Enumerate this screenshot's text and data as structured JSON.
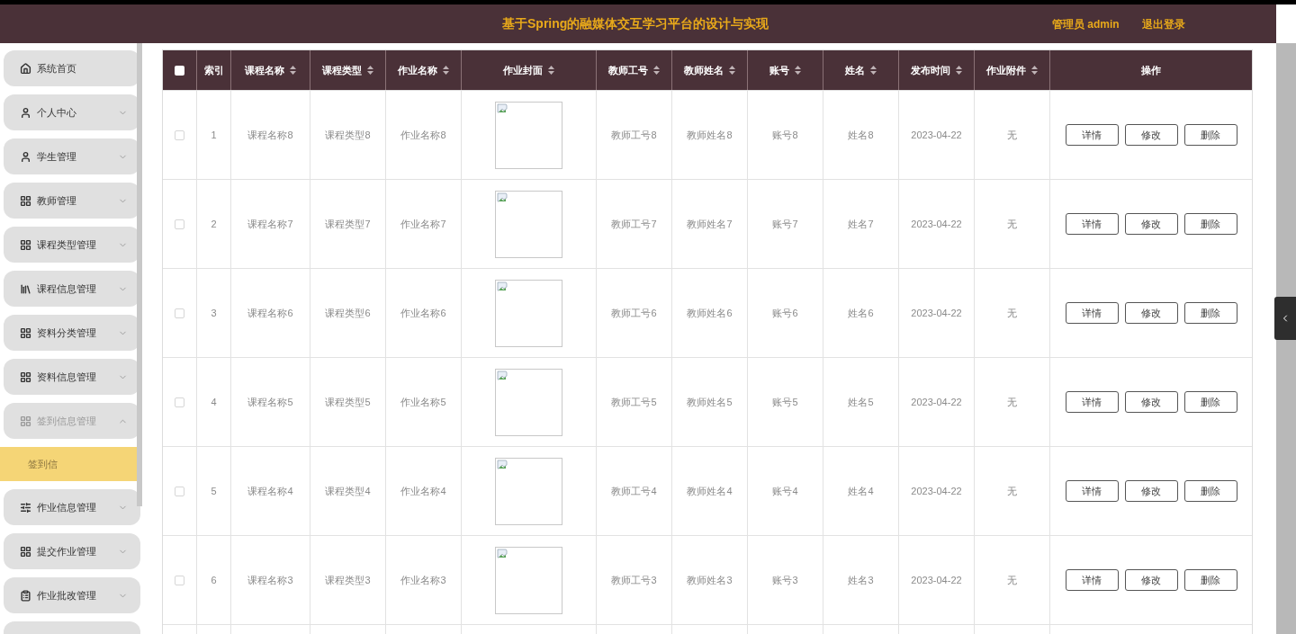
{
  "header": {
    "title": "基于Spring的融媒体交互学习平台的设计与实现",
    "user": "管理员 admin",
    "logout": "退出登录"
  },
  "sidebar": {
    "items": [
      {
        "label": "系统首页",
        "kind": "link"
      },
      {
        "label": "个人中心",
        "kind": "menu",
        "expanded": false
      },
      {
        "label": "学生管理",
        "kind": "menu",
        "expanded": false
      },
      {
        "label": "教师管理",
        "kind": "menu",
        "expanded": false
      },
      {
        "label": "课程类型管理",
        "kind": "menu",
        "expanded": false
      },
      {
        "label": "课程信息管理",
        "kind": "menu",
        "expanded": false
      },
      {
        "label": "资料分类管理",
        "kind": "menu",
        "expanded": false
      },
      {
        "label": "资料信息管理",
        "kind": "menu",
        "expanded": false
      },
      {
        "label": "签到信息管理",
        "kind": "menu",
        "expanded": true,
        "children": [
          {
            "label": "签到信",
            "selected": true
          }
        ]
      },
      {
        "label": "作业信息管理",
        "kind": "menu",
        "expanded": false
      },
      {
        "label": "提交作业管理",
        "kind": "menu",
        "expanded": false
      },
      {
        "label": "作业批改管理",
        "kind": "menu",
        "expanded": false
      }
    ]
  },
  "table": {
    "select_all": {
      "checked": false
    },
    "columns": [
      {
        "label": "索引",
        "sortable": false
      },
      {
        "label": "课程名称",
        "sortable": true
      },
      {
        "label": "课程类型",
        "sortable": true
      },
      {
        "label": "作业名称",
        "sortable": true
      },
      {
        "label": "作业封面",
        "sortable": true
      },
      {
        "label": "教师工号",
        "sortable": true
      },
      {
        "label": "教师姓名",
        "sortable": true
      },
      {
        "label": "账号",
        "sortable": true
      },
      {
        "label": "姓名",
        "sortable": true
      },
      {
        "label": "发布时间",
        "sortable": true
      },
      {
        "label": "作业附件",
        "sortable": true
      },
      {
        "label": "操作",
        "sortable": false
      }
    ],
    "rows": [
      {
        "checked": false,
        "index": "1",
        "course": "课程名称8",
        "type": "课程类型8",
        "homework": "作业名称8",
        "teacher_id": "教师工号8",
        "teacher_name": "教师姓名8",
        "account": "账号8",
        "name": "姓名8",
        "date": "2023-04-22",
        "attachment": "无",
        "actions": [
          "详情",
          "修改",
          "删除"
        ]
      },
      {
        "checked": false,
        "index": "2",
        "course": "课程名称7",
        "type": "课程类型7",
        "homework": "作业名称7",
        "teacher_id": "教师工号7",
        "teacher_name": "教师姓名7",
        "account": "账号7",
        "name": "姓名7",
        "date": "2023-04-22",
        "attachment": "无",
        "actions": [
          "详情",
          "修改",
          "删除"
        ]
      },
      {
        "checked": false,
        "index": "3",
        "course": "课程名称6",
        "type": "课程类型6",
        "homework": "作业名称6",
        "teacher_id": "教师工号6",
        "teacher_name": "教师姓名6",
        "account": "账号6",
        "name": "姓名6",
        "date": "2023-04-22",
        "attachment": "无",
        "actions": [
          "详情",
          "修改",
          "删除"
        ]
      },
      {
        "checked": false,
        "index": "4",
        "course": "课程名称5",
        "type": "课程类型5",
        "homework": "作业名称5",
        "teacher_id": "教师工号5",
        "teacher_name": "教师姓名5",
        "account": "账号5",
        "name": "姓名5",
        "date": "2023-04-22",
        "attachment": "无",
        "actions": [
          "详情",
          "修改",
          "删除"
        ]
      },
      {
        "checked": false,
        "index": "5",
        "course": "课程名称4",
        "type": "课程类型4",
        "homework": "作业名称4",
        "teacher_id": "教师工号4",
        "teacher_name": "教师姓名4",
        "account": "账号4",
        "name": "姓名4",
        "date": "2023-04-22",
        "attachment": "无",
        "actions": [
          "详情",
          "修改",
          "删除"
        ]
      },
      {
        "checked": false,
        "index": "6",
        "course": "课程名称3",
        "type": "课程类型3",
        "homework": "作业名称3",
        "teacher_id": "教师工号3",
        "teacher_name": "教师姓名3",
        "account": "账号3",
        "name": "姓名3",
        "date": "2023-04-22",
        "attachment": "无",
        "actions": [
          "详情",
          "修改",
          "删除"
        ]
      }
    ]
  }
}
